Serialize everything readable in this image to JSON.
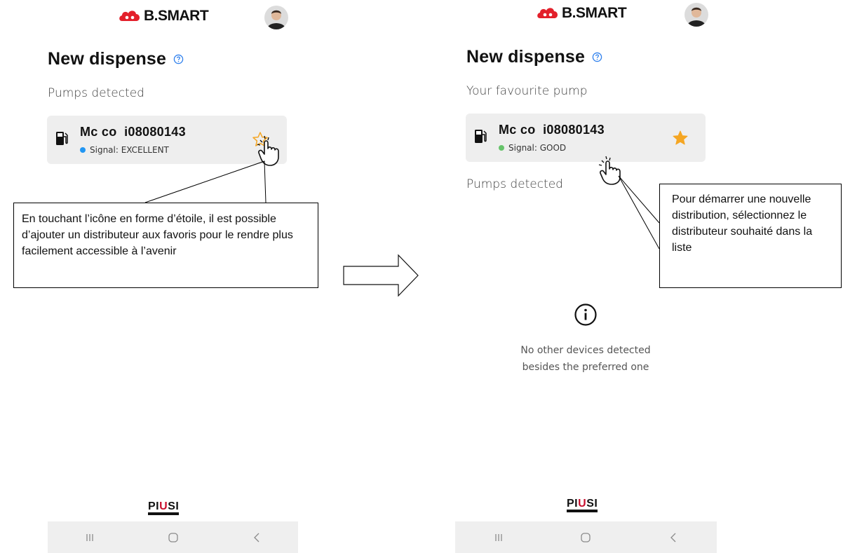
{
  "brand": {
    "logo_text": "B.SMART",
    "accent_color": "#e3202b",
    "footer_logo": {
      "left": "PI",
      "mid": "U",
      "right": "SI"
    }
  },
  "left_screen": {
    "title": "New dispense",
    "section_label": "Pumps detected",
    "pump": {
      "name": "Mc co  i08080143",
      "signal_label": "Signal: EXCELLENT",
      "signal_color": "#2196f3",
      "favourite": false
    }
  },
  "right_screen": {
    "title": "New dispense",
    "favourite_label": "Your favourite pump",
    "pump": {
      "name": "Mc co  i08080143",
      "signal_label": "Signal: GOOD",
      "signal_color": "#66c36a",
      "favourite": true
    },
    "section_label": "Pumps detected",
    "empty_state": {
      "line1": "No other devices detected",
      "line2": "besides the preferred one"
    }
  },
  "callouts": {
    "left": "En touchant l’icône en forme d’étoile, il est possible d’ajouter un distributeur aux favoris pour le rendre plus facilement accessible à l’avenir",
    "right": "Pour démarrer une nouvelle distribution, sélectionnez le distributeur souhaité dans la liste"
  },
  "icons": {
    "help": "help-circle-icon",
    "pump": "fuel-pump-icon",
    "star_outline": "star-outline-icon",
    "star_filled": "star-filled-icon",
    "info": "info-circle-icon",
    "pointer": "pointing-hand-icon",
    "arrow": "right-arrow-icon",
    "recent": "recent-apps-icon",
    "home": "home-icon",
    "back": "back-icon"
  }
}
